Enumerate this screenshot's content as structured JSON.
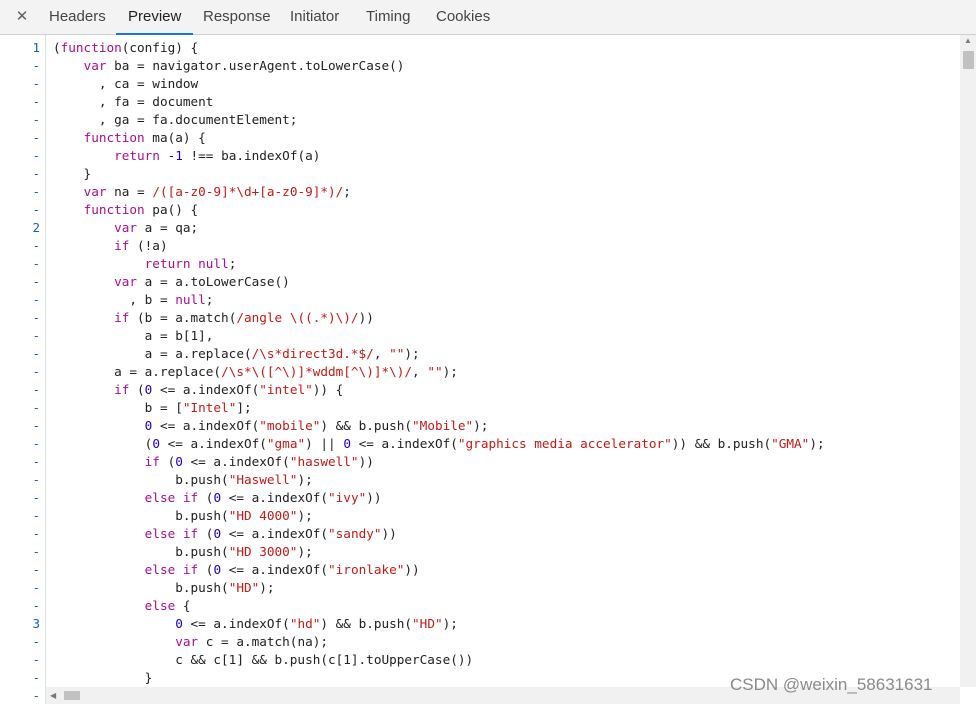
{
  "tabs": {
    "close_label": "✕",
    "items": [
      {
        "label": "Headers"
      },
      {
        "label": "Preview"
      },
      {
        "label": "Response"
      },
      {
        "label": "Initiator"
      },
      {
        "label": "Timing"
      },
      {
        "label": "Cookies"
      }
    ],
    "active": "Preview"
  },
  "gutter": [
    "1",
    "-",
    "-",
    "-",
    "-",
    "-",
    "-",
    "-",
    "-",
    "-",
    "2",
    "-",
    "-",
    "-",
    "-",
    "-",
    "-",
    "-",
    "-",
    "-",
    "-",
    "-",
    "-",
    "-",
    "-",
    "-",
    "-",
    "-",
    "-",
    "-",
    "-",
    "-",
    "3",
    "-",
    "-",
    "-",
    "-",
    "-"
  ],
  "code_lines": [
    "(function(config) {",
    "    var ba = navigator.userAgent.toLowerCase()",
    "      , ca = window",
    "      , fa = document",
    "      , ga = fa.documentElement;",
    "    function ma(a) {",
    "        return -1 !== ba.indexOf(a)",
    "    }",
    "    var na = /([a-z0-9]*\\d+[a-z0-9]*)/;",
    "    function pa() {",
    "        var a = qa;",
    "        if (!a)",
    "            return null;",
    "        var a = a.toLowerCase()",
    "          , b = null;",
    "        if (b = a.match(/angle \\((.*)\\)/))",
    "            a = b[1],",
    "            a = a.replace(/\\s*direct3d.*$/, \"\");",
    "        a = a.replace(/\\s*\\([^\\)]*wddm[^\\)]*\\)/, \"\");",
    "        if (0 <= a.indexOf(\"intel\")) {",
    "            b = [\"Intel\"];",
    "            0 <= a.indexOf(\"mobile\") && b.push(\"Mobile\");",
    "            (0 <= a.indexOf(\"gma\") || 0 <= a.indexOf(\"graphics media accelerator\")) && b.push(\"GMA\");",
    "            if (0 <= a.indexOf(\"haswell\"))",
    "                b.push(\"Haswell\");",
    "            else if (0 <= a.indexOf(\"ivy\"))",
    "                b.push(\"HD 4000\");",
    "            else if (0 <= a.indexOf(\"sandy\"))",
    "                b.push(\"HD 3000\");",
    "            else if (0 <= a.indexOf(\"ironlake\"))",
    "                b.push(\"HD\");",
    "            else {",
    "                0 <= a.indexOf(\"hd\") && b.push(\"HD\");",
    "                var c = a.match(na);",
    "                c && c[1] && b.push(c[1].toUpperCase())",
    "            }"
  ],
  "watermark": "CSDN @weixin_58631631",
  "colors": {
    "keyword": "#aa0d91",
    "string": "#c41a16",
    "number": "#1c00cf",
    "line_number": "#1a5fb4",
    "active_tab_underline": "#1a73e8"
  },
  "icons": {
    "close": "close-icon",
    "scroll_up": "arrow-up-icon",
    "scroll_left": "arrow-left-icon"
  }
}
